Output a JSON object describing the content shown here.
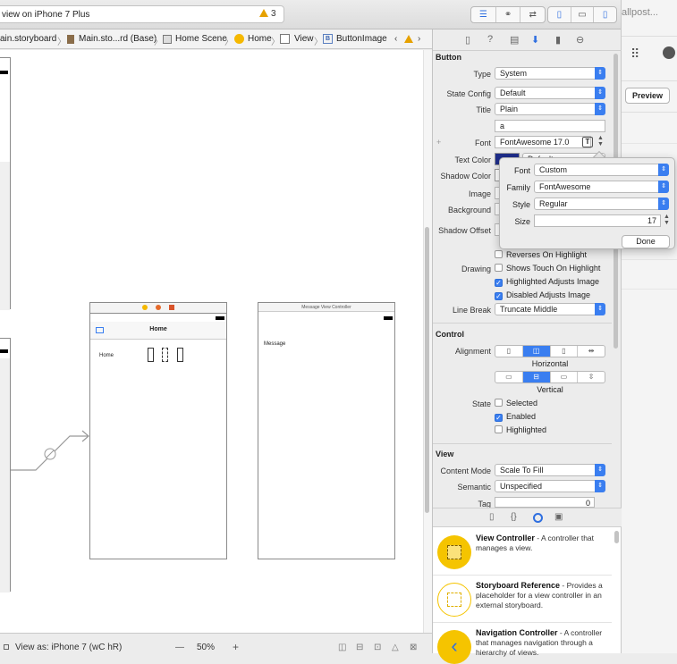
{
  "toolbar": {
    "activity_text": "view on iPhone 7 Plus",
    "warning_count": "3"
  },
  "jumpbar": {
    "crumbs": [
      "ain.storyboard",
      "Main.sto...rd (Base)",
      "Home Scene",
      "Home",
      "View",
      "ButtonImage"
    ]
  },
  "canvas": {
    "home_title": "Home",
    "home_label": "Home",
    "message_nav_title": "Message View Controller",
    "message_label": "Message"
  },
  "bottombar": {
    "view_as": "View as: iPhone 7 (wC hR)",
    "zoom": "50%",
    "minus": "—",
    "plus": "+"
  },
  "inspector": {
    "button_section": "Button",
    "type_label": "Type",
    "type_value": "System",
    "state_config_label": "State Config",
    "state_config_value": "Default",
    "title_label": "Title",
    "title_value": "Plain",
    "title_text": "a",
    "font_label": "Font",
    "font_value": "FontAwesome 17.0",
    "text_color_label": "Text Color",
    "text_color_value": "Default",
    "shadow_color_label": "Shadow Color",
    "image_label": "Image",
    "background_label": "Background",
    "shadow_offset_label": "Shadow Offset",
    "reverses": "Reverses On Highlight",
    "drawing_label": "Drawing",
    "shows_touch": "Shows Touch On Highlight",
    "highlighted_adjusts": "Highlighted Adjusts Image",
    "disabled_adjusts": "Disabled Adjusts Image",
    "line_break_label": "Line Break",
    "line_break_value": "Truncate Middle",
    "control_section": "Control",
    "alignment_label": "Alignment",
    "horizontal": "Horizontal",
    "vertical": "Vertical",
    "state_label": "State",
    "selected": "Selected",
    "enabled": "Enabled",
    "highlighted": "Highlighted",
    "view_section": "View",
    "content_mode_label": "Content Mode",
    "content_mode_value": "Scale To Fill",
    "semantic_label": "Semantic",
    "semantic_value": "Unspecified",
    "tag_label": "Tag",
    "tag_value": "0"
  },
  "font_popover": {
    "font_label": "Font",
    "font_value": "Custom",
    "family_label": "Family",
    "family_value": "FontAwesome",
    "style_label": "Style",
    "style_value": "Regular",
    "size_label": "Size",
    "size_value": "17",
    "done": "Done"
  },
  "library": {
    "items": [
      {
        "title": "View Controller",
        "desc": " - A controller that manages a view."
      },
      {
        "title": "Storyboard Reference",
        "desc": " - Provides a placeholder for a view controller in an external storyboard."
      },
      {
        "title": "Navigation Controller",
        "desc": " - A controller that manages navigation through a hierarchy of views."
      }
    ]
  },
  "right_window": {
    "tab_text": "allpost...",
    "preview": "Preview"
  },
  "colors": {
    "accent": "#3a7ef0",
    "library_icon": "#f5c400",
    "warning": "#e6a100"
  }
}
